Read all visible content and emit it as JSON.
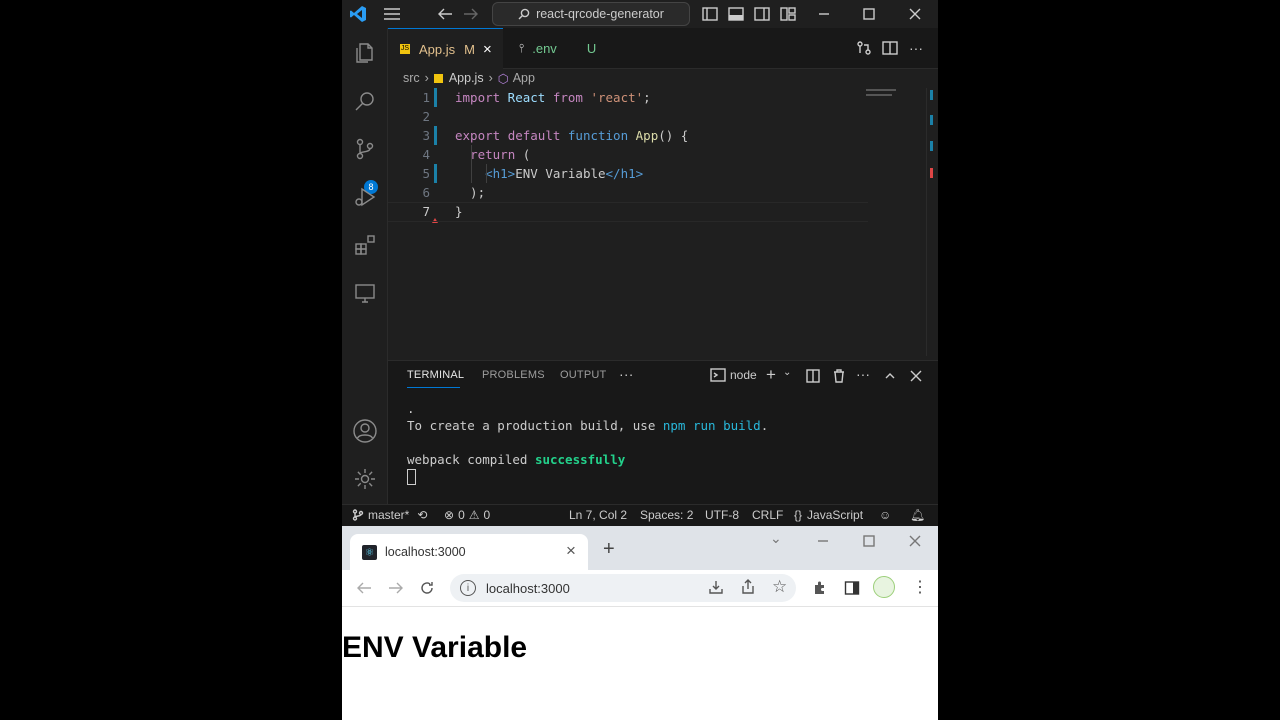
{
  "vscode": {
    "search_text": "react-qrcode-generator",
    "source_control_badge": "8",
    "tabs": [
      {
        "label": "App.js",
        "status": "M"
      },
      {
        "label": ".env",
        "status": "U"
      }
    ],
    "breadcrumb": {
      "folder": "src",
      "file": "App.js",
      "symbol": "App"
    },
    "code_lines": [
      {
        "number": "1",
        "parts": [
          {
            "t": "import",
            "c": "kw"
          },
          {
            "t": " React ",
            "c": "id"
          },
          {
            "t": "from",
            "c": "kw"
          },
          {
            "t": " ",
            "c": ""
          },
          {
            "t": "'react'",
            "c": "str"
          },
          {
            "t": ";",
            "c": ""
          }
        ]
      },
      {
        "number": "2",
        "parts": []
      },
      {
        "number": "3",
        "parts": [
          {
            "t": "export",
            "c": "kw"
          },
          {
            "t": " ",
            "c": ""
          },
          {
            "t": "default",
            "c": "kw"
          },
          {
            "t": " ",
            "c": ""
          },
          {
            "t": "function",
            "c": "kw2"
          },
          {
            "t": " ",
            "c": ""
          },
          {
            "t": "App",
            "c": "fn"
          },
          {
            "t": "() {",
            "c": ""
          }
        ]
      },
      {
        "number": "4",
        "parts": [
          {
            "t": "  ",
            "c": ""
          },
          {
            "t": "return",
            "c": "kw"
          },
          {
            "t": " (",
            "c": ""
          }
        ]
      },
      {
        "number": "5",
        "parts": [
          {
            "t": "    ",
            "c": ""
          },
          {
            "t": "<h1>",
            "c": "tag"
          },
          {
            "t": "ENV Variable",
            "c": ""
          },
          {
            "t": "</h1>",
            "c": "tag"
          }
        ]
      },
      {
        "number": "6",
        "parts": [
          {
            "t": "  );",
            "c": ""
          }
        ]
      },
      {
        "number": "7",
        "parts": [
          {
            "t": "}",
            "c": ""
          }
        ]
      }
    ],
    "panel_tabs": [
      "TERMINAL",
      "PROBLEMS",
      "OUTPUT"
    ],
    "terminal_name": "node",
    "terminal_lines": [
      [
        {
          "t": ".",
          "c": ""
        }
      ],
      [
        {
          "t": "To create a production build, use ",
          "c": ""
        },
        {
          "t": "npm run build",
          "c": "cyan"
        },
        {
          "t": ".",
          "c": ""
        }
      ],
      [],
      [
        {
          "t": "webpack compiled ",
          "c": ""
        },
        {
          "t": "successfully",
          "c": "green"
        }
      ]
    ],
    "status": {
      "branch": "master*",
      "errors": "0",
      "warnings": "0",
      "position": "Ln 7, Col 2",
      "spaces": "Spaces: 2",
      "encoding": "UTF-8",
      "eol": "CRLF",
      "language": "JavaScript"
    }
  },
  "browser": {
    "tab_title": "localhost:3000",
    "url": "localhost:3000",
    "page_heading": "ENV Variable"
  },
  "colors": {
    "accent": "#0078d4",
    "success_green": "#23d18b",
    "link_cyan": "#29b8db"
  }
}
